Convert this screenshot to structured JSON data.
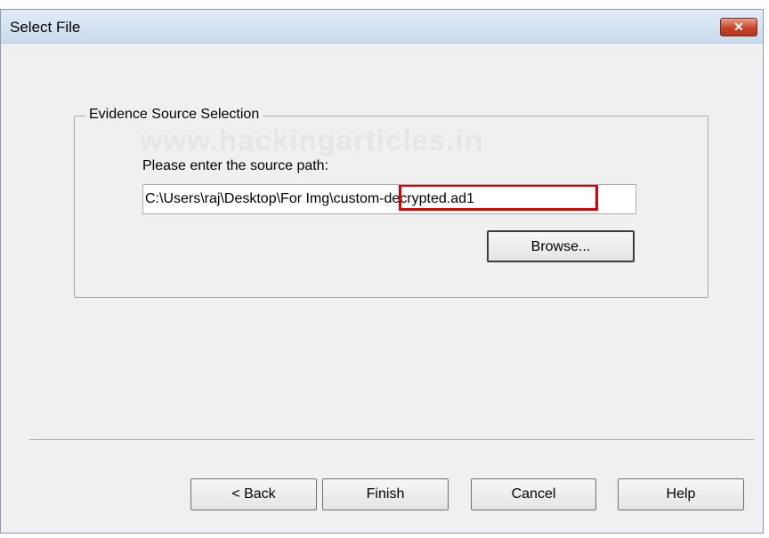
{
  "window": {
    "title": "Select File",
    "close_glyph": "✕"
  },
  "group": {
    "legend": "Evidence Source Selection",
    "watermark": "www.hackingarticles.in",
    "prompt": "Please enter the source path:",
    "path_value_prefix": "C:\\Users\\raj\\Desktop\\For Img",
    "path_value_highlighted": "\\custom-decrypted.ad1",
    "browse_label": "Browse..."
  },
  "footer": {
    "back_label": "< Back",
    "finish_label": "Finish",
    "cancel_label": "Cancel",
    "help_label": "Help"
  },
  "colors": {
    "highlight": "#e00000",
    "dialog_bg": "#f0f0f0",
    "close_button": "#c8432a"
  }
}
